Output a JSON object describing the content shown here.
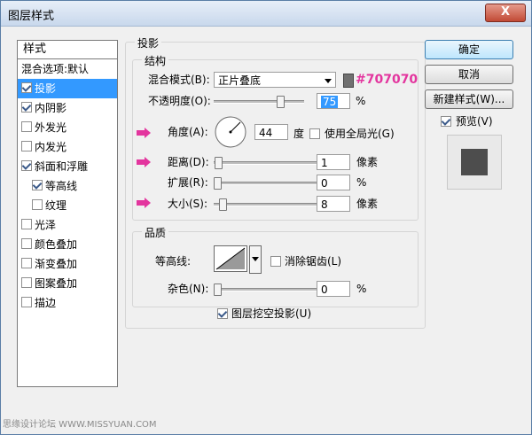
{
  "window": {
    "title": "图层样式",
    "close_label": "X"
  },
  "styles_list": {
    "header": "样式",
    "items": [
      {
        "label": "混合选项:默认",
        "has_checkbox": false,
        "checked": false,
        "selected": false,
        "indent": false
      },
      {
        "label": "投影",
        "has_checkbox": true,
        "checked": true,
        "selected": true,
        "indent": false
      },
      {
        "label": "内阴影",
        "has_checkbox": true,
        "checked": true,
        "selected": false,
        "indent": false
      },
      {
        "label": "外发光",
        "has_checkbox": true,
        "checked": false,
        "selected": false,
        "indent": false
      },
      {
        "label": "内发光",
        "has_checkbox": true,
        "checked": false,
        "selected": false,
        "indent": false
      },
      {
        "label": "斜面和浮雕",
        "has_checkbox": true,
        "checked": true,
        "selected": false,
        "indent": false
      },
      {
        "label": "等高线",
        "has_checkbox": true,
        "checked": true,
        "selected": false,
        "indent": true
      },
      {
        "label": "纹理",
        "has_checkbox": true,
        "checked": false,
        "selected": false,
        "indent": true
      },
      {
        "label": "光泽",
        "has_checkbox": true,
        "checked": false,
        "selected": false,
        "indent": false
      },
      {
        "label": "颜色叠加",
        "has_checkbox": true,
        "checked": false,
        "selected": false,
        "indent": false
      },
      {
        "label": "渐变叠加",
        "has_checkbox": true,
        "checked": false,
        "selected": false,
        "indent": false
      },
      {
        "label": "图案叠加",
        "has_checkbox": true,
        "checked": false,
        "selected": false,
        "indent": false
      },
      {
        "label": "描边",
        "has_checkbox": true,
        "checked": false,
        "selected": false,
        "indent": false
      }
    ]
  },
  "drop_shadow": {
    "group_label": "投影",
    "structure": {
      "group_label": "结构",
      "blend_mode_label": "混合模式(B):",
      "blend_mode_value": "正片叠底",
      "color_hex": "#707070",
      "opacity_label": "不透明度(O):",
      "opacity_value": "75",
      "opacity_unit": "%",
      "angle_label": "角度(A):",
      "angle_value": "44",
      "angle_unit": "度",
      "global_light_label": "使用全局光(G)",
      "global_light_checked": false,
      "distance_label": "距离(D):",
      "distance_value": "1",
      "distance_unit": "像素",
      "spread_label": "扩展(R):",
      "spread_value": "0",
      "spread_unit": "%",
      "size_label": "大小(S):",
      "size_value": "8",
      "size_unit": "像素"
    },
    "quality": {
      "group_label": "品质",
      "contour_label": "等高线:",
      "anti_alias_label": "消除锯齿(L)",
      "anti_alias_checked": false,
      "noise_label": "杂色(N):",
      "noise_value": "0",
      "noise_unit": "%"
    },
    "knockout_label": "图层挖空投影(U)",
    "knockout_checked": true
  },
  "buttons": {
    "ok": "确定",
    "cancel": "取消",
    "new_style": "新建样式(W)...",
    "preview_label": "预览(V)",
    "preview_checked": true
  },
  "watermark": "思缘设计论坛  WWW.MISSYUAN.COM",
  "colors": {
    "highlight": "#3399ff",
    "annotation_pink": "#e3359e",
    "shadow_color": "#707070"
  },
  "slider_levels": {
    "opacity": 0.75,
    "distance": 0.01,
    "spread": 0.0,
    "size": 0.05,
    "noise": 0.0
  }
}
